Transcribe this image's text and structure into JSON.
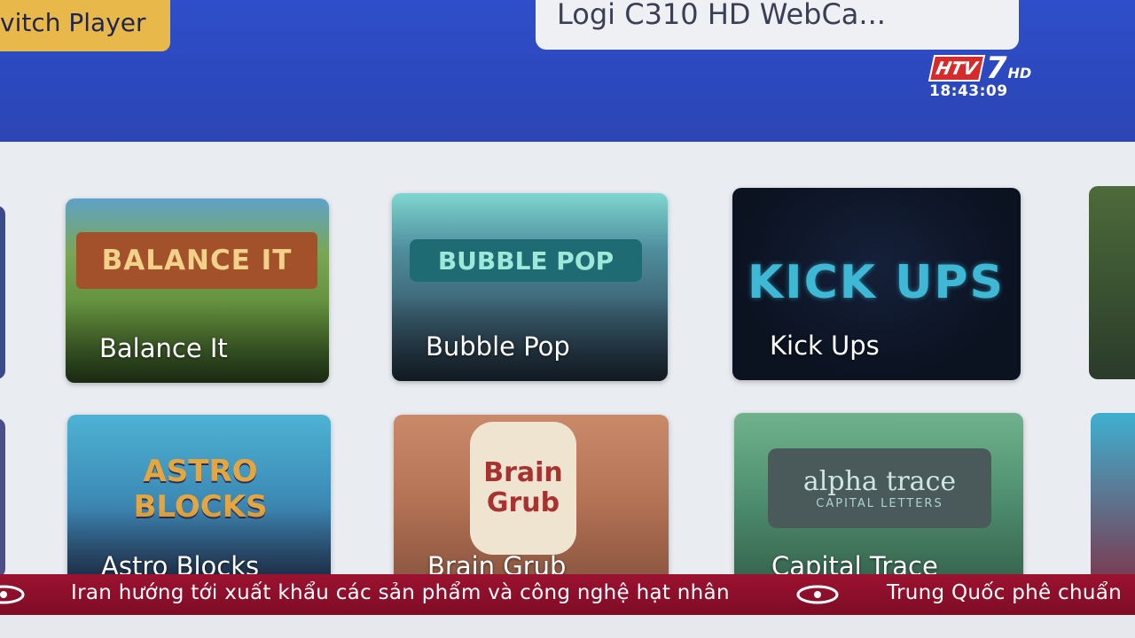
{
  "header": {
    "switch_player_label": "vitch Player",
    "camera_label": "Logi C310 HD WebCa..."
  },
  "broadcast": {
    "channel_logo": "HTV",
    "channel_number": "7",
    "channel_hd": "HD",
    "time": "18:43:09"
  },
  "games": [
    {
      "title": "Balance It",
      "banner": "BALANCE IT"
    },
    {
      "title": "Bubble Pop",
      "banner": "BUBBLE POP"
    },
    {
      "title": "Kick Ups",
      "banner": "KICK UPS"
    },
    {
      "title": "Astro Blocks",
      "banner": "ASTRO BLOCKS"
    },
    {
      "title": "Brain Grub",
      "banner": "Brain Grub"
    },
    {
      "title": "Capital Trace",
      "banner": "alpha trace",
      "banner_sub": "CAPITAL LETTERS"
    }
  ],
  "ticker": {
    "headline_1": "Iran hướng tới xuất khẩu các sản phẩm và công nghệ hạt nhân",
    "headline_2": "Trung Quốc phê chuẩn",
    "logo_icon": "htv-ticker-logo-icon"
  },
  "colors": {
    "header_blue": "#2d4bc3",
    "switch_button": "#e8b94a",
    "ticker_red": "#8e0f2b"
  }
}
